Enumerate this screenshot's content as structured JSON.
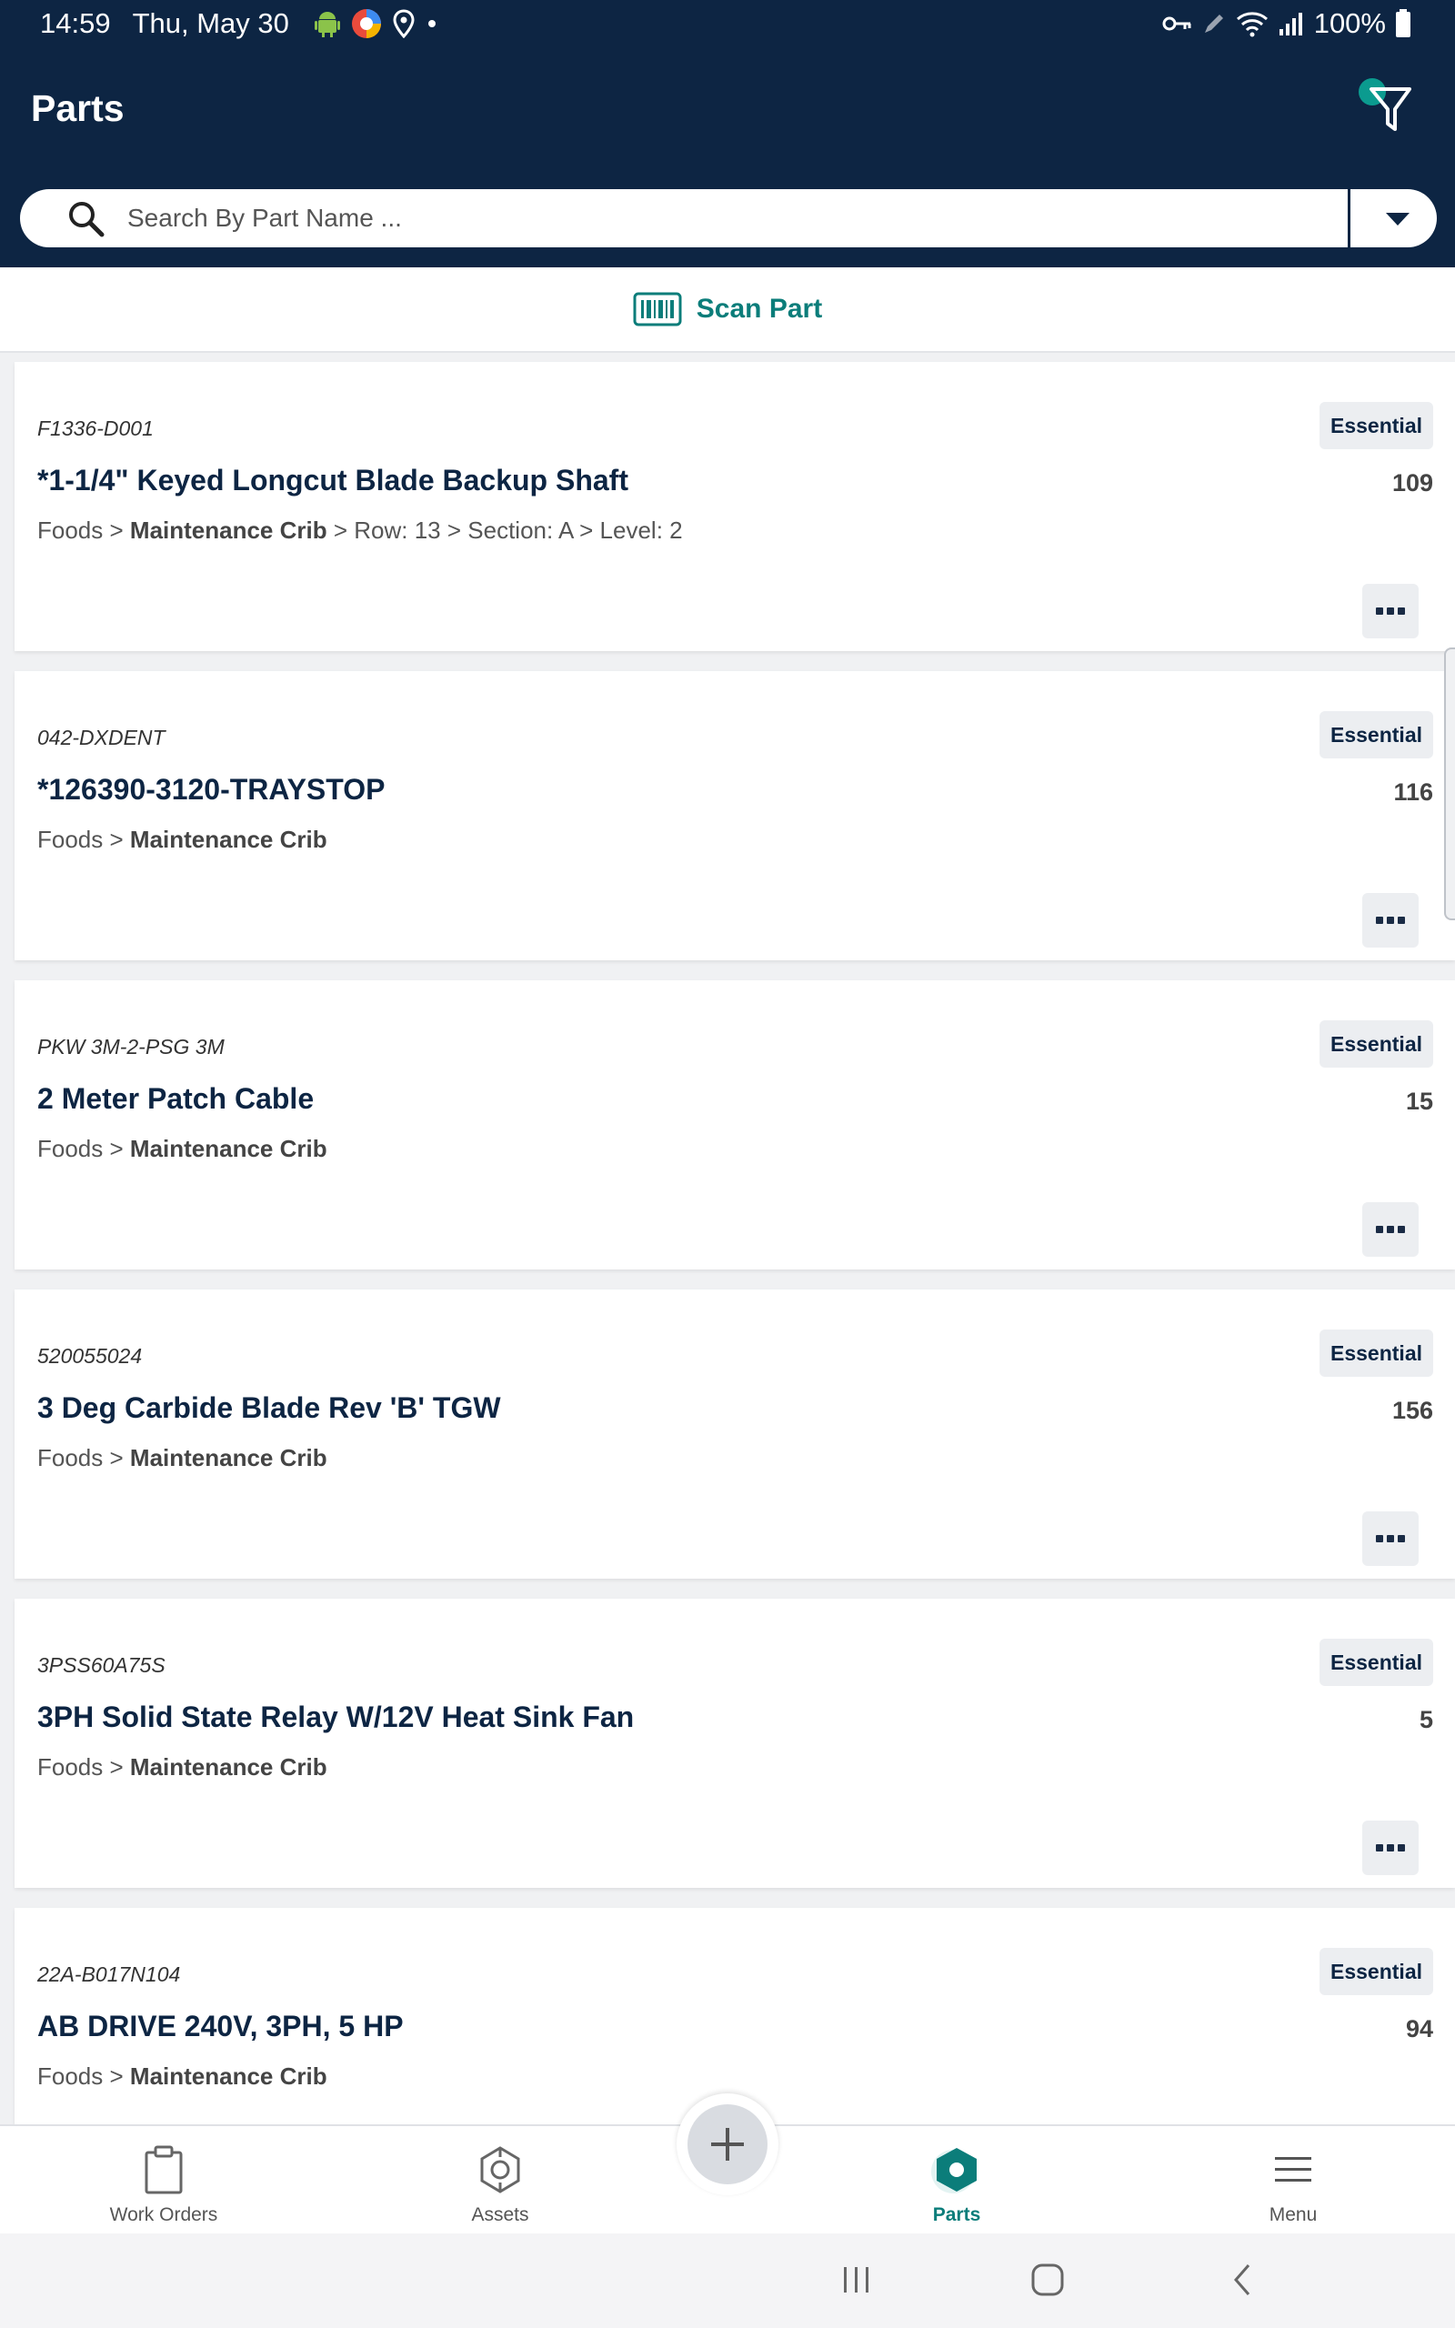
{
  "status_bar": {
    "time": "14:59",
    "date": "Thu, May 30",
    "battery": "100%",
    "left_icons": [
      "android-icon",
      "browser-icon",
      "location-icon",
      "dot-icon"
    ],
    "right_icons": [
      "key-icon",
      "pen-icon",
      "wifi-icon",
      "signal-icon",
      "battery-icon"
    ]
  },
  "header": {
    "title": "Parts",
    "filter_icon": "filter-icon",
    "accent_color": "#0b9b8f",
    "background_color": "#0d2543"
  },
  "search": {
    "placeholder": "Search By Part Name ...",
    "value": ""
  },
  "scan": {
    "label": "Scan Part",
    "icon": "barcode-icon"
  },
  "parts": [
    {
      "code": "F1336-D001",
      "badge": "Essential",
      "name": "*1-1/4\" Keyed Longcut Blade Backup Shaft",
      "qty": "109",
      "loc_prefix": "Foods > ",
      "loc_bold": "Maintenance Crib",
      "loc_suffix": " > Row: 13  >  Section: A  >  Level: 2"
    },
    {
      "code": "042-DXDENT",
      "badge": "Essential",
      "name": "*126390-3120-TRAYSTOP",
      "qty": "116",
      "loc_prefix": "Foods > ",
      "loc_bold": "Maintenance Crib",
      "loc_suffix": ""
    },
    {
      "code": "PKW 3M-2-PSG 3M",
      "badge": "Essential",
      "name": "2 Meter Patch Cable",
      "qty": "15",
      "loc_prefix": "Foods > ",
      "loc_bold": "Maintenance Crib",
      "loc_suffix": ""
    },
    {
      "code": "520055024",
      "badge": "Essential",
      "name": "3 Deg Carbide Blade Rev 'B' TGW",
      "qty": "156",
      "loc_prefix": "Foods > ",
      "loc_bold": "Maintenance Crib",
      "loc_suffix": ""
    },
    {
      "code": "3PSS60A75S",
      "badge": "Essential",
      "name": "3PH Solid State Relay W/12V Heat Sink Fan",
      "qty": "5",
      "loc_prefix": "Foods > ",
      "loc_bold": "Maintenance Crib",
      "loc_suffix": ""
    },
    {
      "code": "22A-B017N104",
      "badge": "Essential",
      "name": "AB DRIVE 240V, 3PH, 5 HP",
      "qty": "94",
      "loc_prefix": "Foods > ",
      "loc_bold": "Maintenance Crib",
      "loc_suffix": ""
    }
  ],
  "bottom_nav": {
    "items": [
      {
        "label": "Work Orders",
        "icon": "clipboard-icon"
      },
      {
        "label": "Assets",
        "icon": "asset-icon"
      },
      {
        "label": "Parts",
        "icon": "hex-nut-icon",
        "active": true
      },
      {
        "label": "Menu",
        "icon": "hamburger-icon"
      }
    ],
    "add_icon": "plus-icon"
  },
  "system_nav": {
    "icons": [
      "recent-apps-icon",
      "home-icon",
      "back-icon"
    ]
  }
}
